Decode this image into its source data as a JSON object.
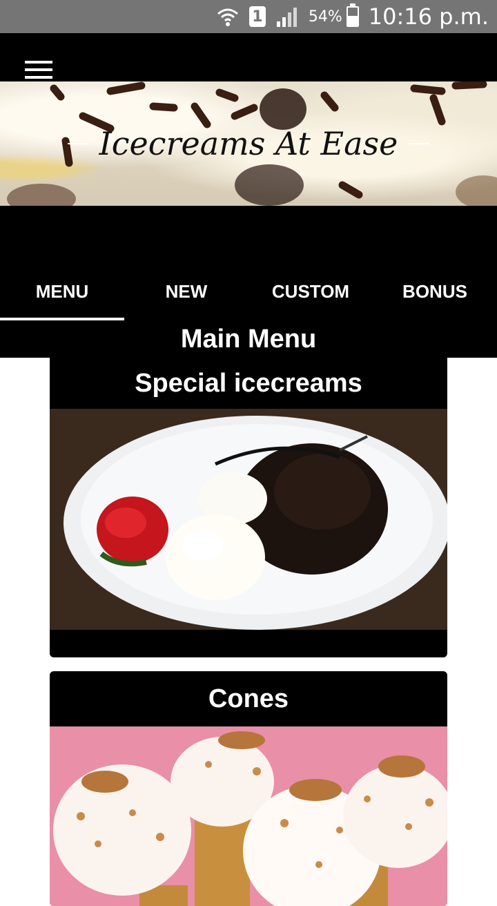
{
  "status_bar": {
    "icons": [
      "wifi-icon",
      "sim-icon",
      "signal-icon",
      "battery-icon"
    ],
    "sim_label": "1",
    "battery_percent": "54%",
    "battery_level": 0.54,
    "time": "10:16 p.m."
  },
  "header": {
    "menu_icon": "hamburger-menu-icon",
    "banner_title": "Icecreams At Ease"
  },
  "tabs": [
    {
      "label": "MENU",
      "active": true
    },
    {
      "label": "NEW",
      "active": false
    },
    {
      "label": "CUSTOM",
      "active": false
    },
    {
      "label": "BONUS",
      "active": false
    }
  ],
  "main": {
    "section_title": "Main Menu",
    "cards": [
      {
        "title": "Special icecreams"
      },
      {
        "title": "Cones"
      }
    ]
  },
  "colors": {
    "status_bar": "#757575",
    "app_background": "#000000",
    "text_on_dark": "#ffffff",
    "cones_image_background": "#e98fa7"
  }
}
